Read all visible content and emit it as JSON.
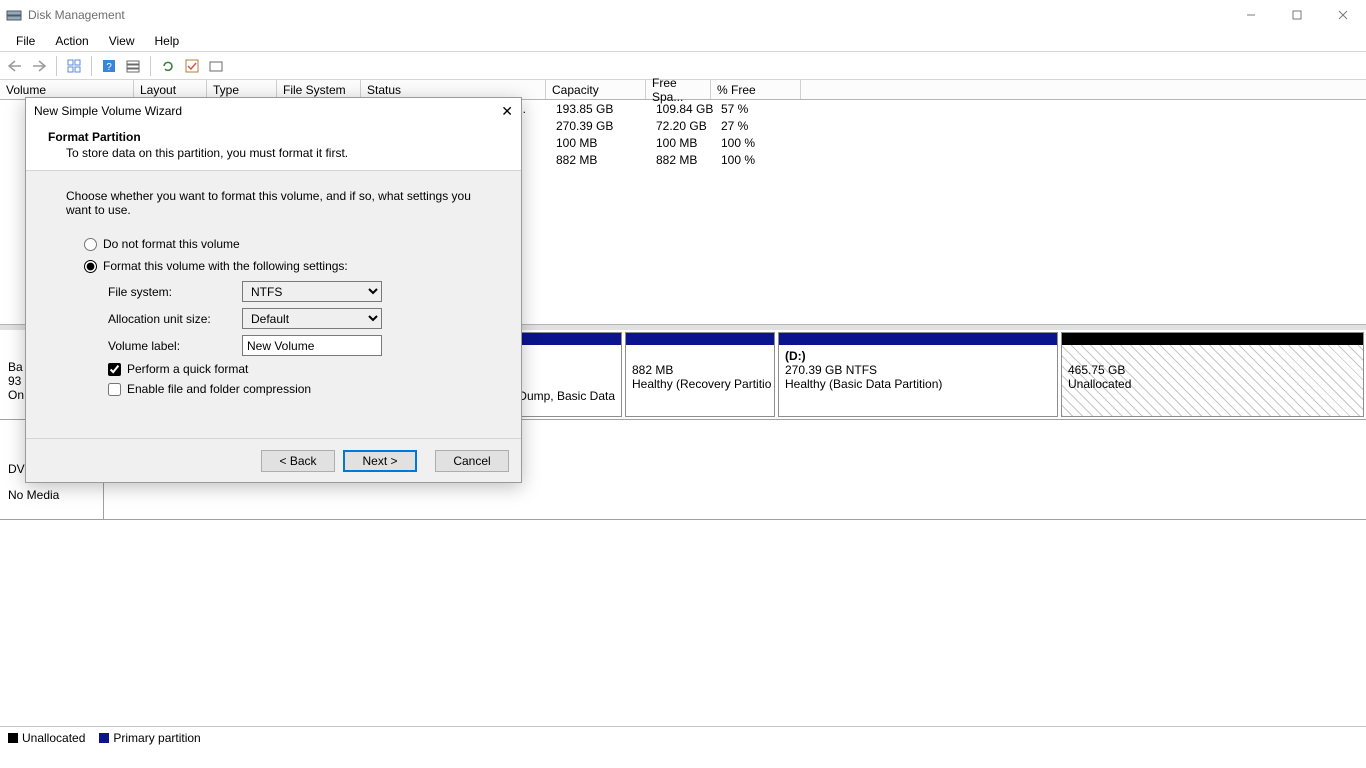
{
  "window": {
    "title": "Disk Management",
    "menu": [
      "File",
      "Action",
      "View",
      "Help"
    ]
  },
  "columns": {
    "volume": "Volume",
    "layout": "Layout",
    "type": "Type",
    "fs": "File System",
    "status": "Status",
    "capacity": "Capacity",
    "free": "Free Spa...",
    "pctfree": "% Free"
  },
  "volumes": [
    {
      "status_tail": "n ...",
      "capacity": "193.85 GB",
      "free": "109.84 GB",
      "pct": "57 %"
    },
    {
      "status_tail": "",
      "capacity": "270.39 GB",
      "free": "72.20 GB",
      "pct": "27 %"
    },
    {
      "status_tail": "",
      "capacity": "100 MB",
      "free": "100 MB",
      "pct": "100 %"
    },
    {
      "status_tail": "",
      "capacity": "882 MB",
      "free": "882 MB",
      "pct": "100 %"
    }
  ],
  "disk0": {
    "label_line1": "Ba",
    "label_line2": "93",
    "label_line3": "On",
    "p1": {
      "tail": "Dump, Basic Data"
    },
    "p2": {
      "size": "882 MB",
      "status": "Healthy (Recovery Partitio"
    },
    "p3": {
      "letter": "(D:)",
      "size": "270.39 GB NTFS",
      "status": "Healthy (Basic Data Partition)"
    },
    "p4": {
      "size": "465.75 GB",
      "status": "Unallocated"
    }
  },
  "dvd": {
    "label": "DV",
    "status": "No Media"
  },
  "legend": {
    "unalloc": "Unallocated",
    "primary": "Primary partition"
  },
  "wizard": {
    "title": "New Simple Volume Wizard",
    "head": "Format Partition",
    "sub": "To store data on this partition, you must format it first.",
    "intro": "Choose whether you want to format this volume, and if so, what settings you want to use.",
    "opt_noformat": "Do not format this volume",
    "opt_format": "Format this volume with the following settings:",
    "lbl_fs": "File system:",
    "lbl_au": "Allocation unit size:",
    "lbl_vl": "Volume label:",
    "val_fs": "NTFS",
    "val_au": "Default",
    "val_vl": "New Volume",
    "chk_quick": "Perform a quick format",
    "chk_compress": "Enable file and folder compression",
    "btn_back": "< Back",
    "btn_next": "Next >",
    "btn_cancel": "Cancel"
  }
}
